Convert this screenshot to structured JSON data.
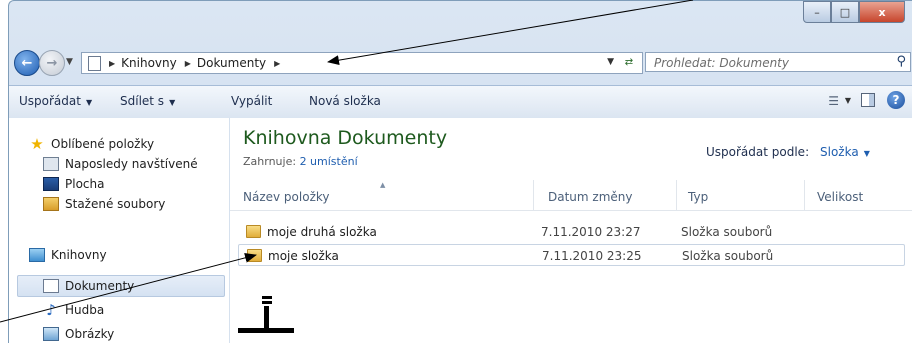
{
  "window": {
    "close_glyph": "x"
  },
  "address": {
    "crumbs": [
      "Knihovny",
      "Dokumenty"
    ],
    "search_placeholder": "Prohledat: Dokumenty"
  },
  "toolbar": {
    "organize": "Uspořádat",
    "share": "Sdílet s",
    "burn": "Vypálit",
    "new_folder": "Nová složka"
  },
  "sidebar": {
    "favorites": "Oblíbené položky",
    "recent": "Naposledy navštívené",
    "desktop": "Plocha",
    "downloads": "Stažené soubory",
    "libraries": "Knihovny",
    "documents": "Dokumenty",
    "music": "Hudba",
    "pictures": "Obrázky"
  },
  "content": {
    "title": "Knihovna Dokumenty",
    "includes_label": "Zahrnuje:",
    "includes_link": "2 umístění",
    "arrange_label": "Uspořádat podle:",
    "arrange_value": "Složka",
    "columns": [
      "Název položky",
      "Datum změny",
      "Typ",
      "Velikost"
    ],
    "rows": [
      {
        "name": "moje druhá složka",
        "date": "7.11.2010 23:27",
        "type": "Složka souborů"
      },
      {
        "name": "moje složka",
        "date": "7.11.2010 23:25",
        "type": "Složka souborů"
      }
    ]
  },
  "colors": {
    "accent": "#1f5eaf",
    "title_green": "#1e5a1e",
    "annotation": "#000000"
  }
}
